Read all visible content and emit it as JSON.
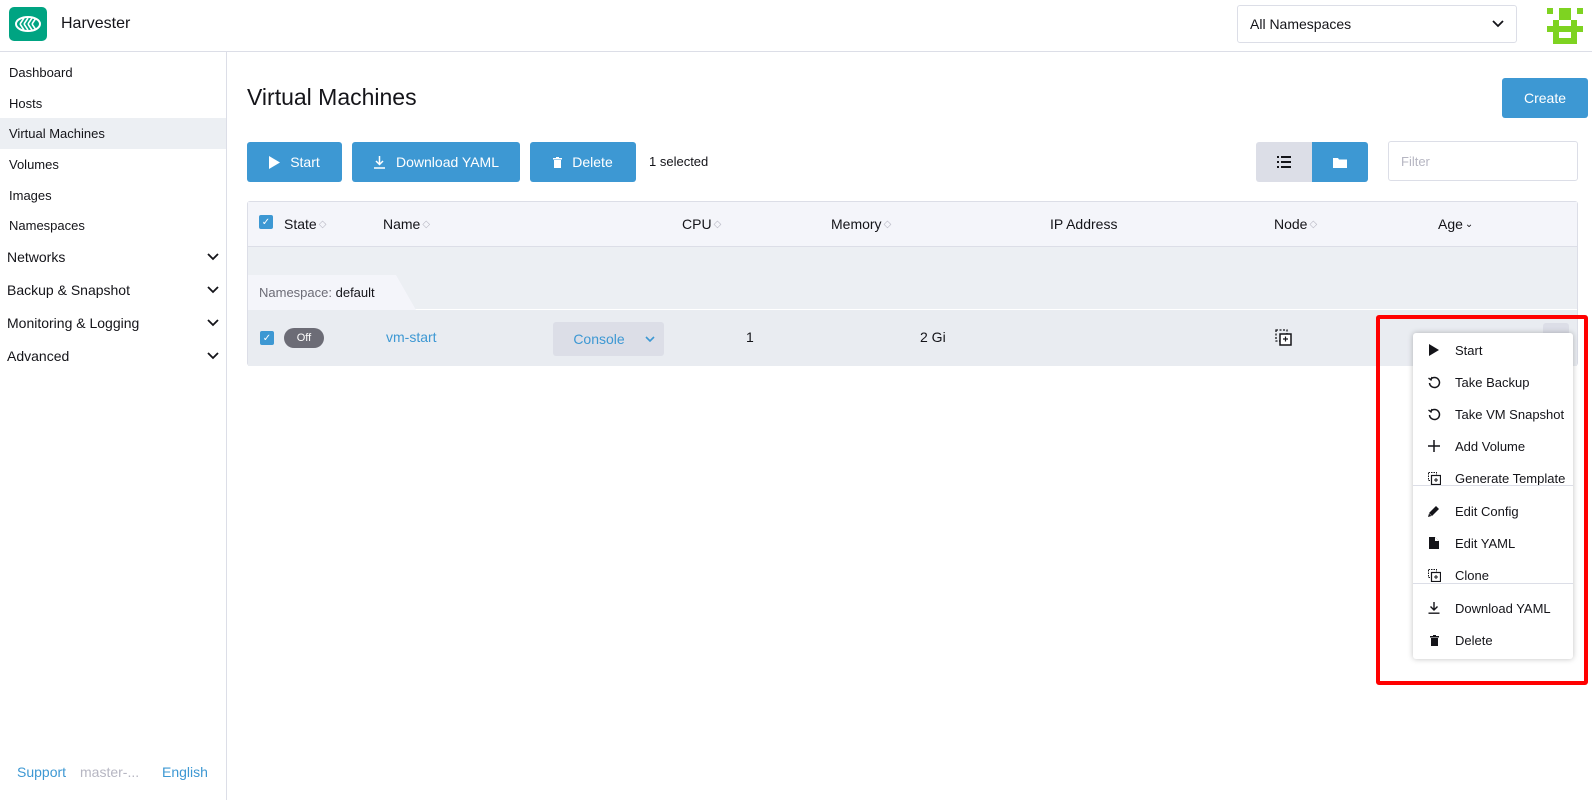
{
  "header": {
    "app_name": "Harvester",
    "namespace_selector": "All Namespaces"
  },
  "sidebar": {
    "items": [
      {
        "label": "Dashboard"
      },
      {
        "label": "Hosts"
      },
      {
        "label": "Virtual Machines",
        "active": true
      },
      {
        "label": "Volumes"
      },
      {
        "label": "Images"
      },
      {
        "label": "Namespaces"
      }
    ],
    "groups": [
      {
        "label": "Networks"
      },
      {
        "label": "Backup & Snapshot"
      },
      {
        "label": "Monitoring & Logging"
      },
      {
        "label": "Advanced"
      }
    ],
    "footer": {
      "support": "Support",
      "version": "master-...",
      "language": "English"
    }
  },
  "main": {
    "title": "Virtual Machines",
    "create_label": "Create",
    "bulk_actions": {
      "start": "Start",
      "download_yaml": "Download YAML",
      "delete": "Delete",
      "selected_count": "1 selected"
    },
    "filter_placeholder": "Filter",
    "table": {
      "columns": [
        "State",
        "Name",
        "CPU",
        "Memory",
        "IP Address",
        "Node",
        "Age"
      ],
      "group": {
        "label": "Namespace:",
        "value": "default"
      },
      "rows": [
        {
          "state": "Off",
          "name": "vm-start",
          "console": "Console",
          "cpu": "1",
          "memory": "2 Gi",
          "ip_address": "",
          "node": "",
          "age": ""
        }
      ]
    }
  },
  "context_menu": {
    "items": [
      {
        "label": "Start",
        "icon": "play-icon"
      },
      {
        "label": "Take Backup",
        "icon": "backup-icon"
      },
      {
        "label": "Take VM Snapshot",
        "icon": "snapshot-icon"
      },
      {
        "label": "Add Volume",
        "icon": "plus-icon"
      },
      {
        "label": "Generate Template",
        "icon": "template-icon"
      },
      {
        "label": "Edit Config",
        "icon": "pencil-icon"
      },
      {
        "label": "Edit YAML",
        "icon": "file-icon"
      },
      {
        "label": "Clone",
        "icon": "clone-icon"
      },
      {
        "label": "Download YAML",
        "icon": "download-icon"
      },
      {
        "label": "Delete",
        "icon": "trash-icon"
      }
    ]
  },
  "colors": {
    "primary": "#3d98d3",
    "brand": "#00a482",
    "highlight": "#ff0000"
  }
}
